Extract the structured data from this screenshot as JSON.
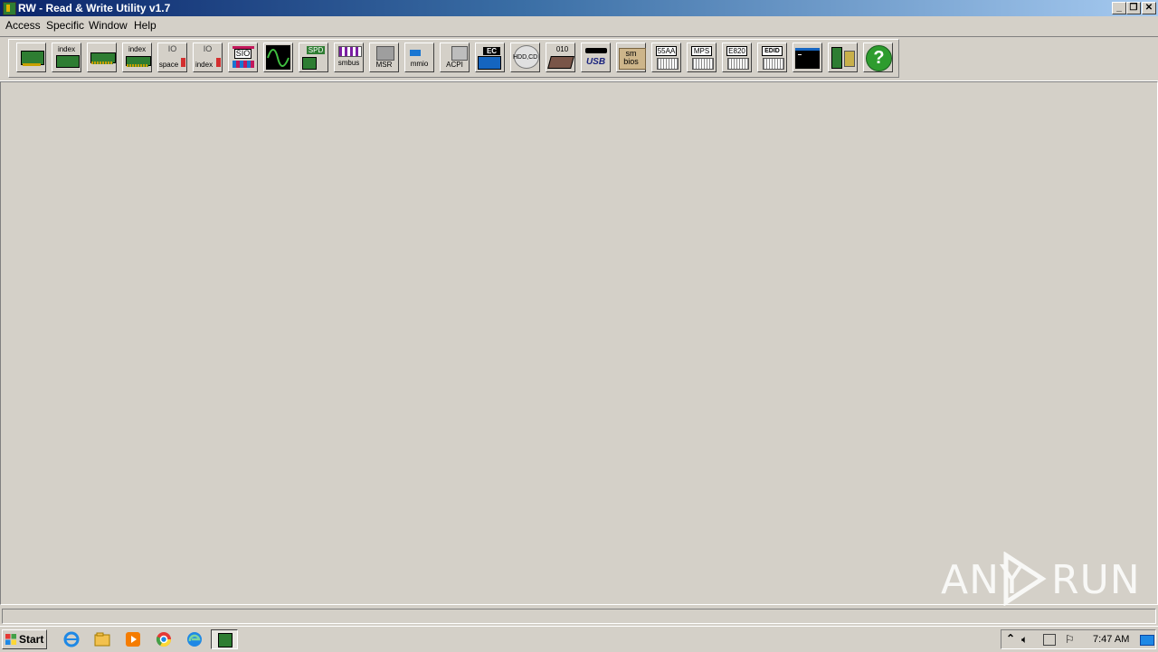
{
  "window": {
    "title": "RW - Read & Write Utility v1.7",
    "caption_buttons": [
      "minimize",
      "restore",
      "close"
    ]
  },
  "menubar": {
    "items": [
      "Access",
      "Specific",
      "Window",
      "Help"
    ]
  },
  "toolbar": {
    "labels": {
      "index1": "index",
      "index2": "index",
      "io_space": "space",
      "io_index": "index",
      "sio": "SIO",
      "spd": "SPD",
      "smbus": "smbus",
      "msr": "MSR",
      "mmio": "mmio",
      "acpi": "ACPI",
      "ec": "EC",
      "hdd": "HDD,CD",
      "bin": "010",
      "usb": "USB",
      "smbios_top": "sm",
      "smbios_bot": "bios",
      "aa55": "55AA",
      "mps": "MPS",
      "e820": "E820",
      "edid": "EDID"
    }
  },
  "watermark": {
    "left": "ANY",
    "right": "RUN"
  },
  "taskbar": {
    "start_label": "Start",
    "clock": "7:47 AM"
  }
}
